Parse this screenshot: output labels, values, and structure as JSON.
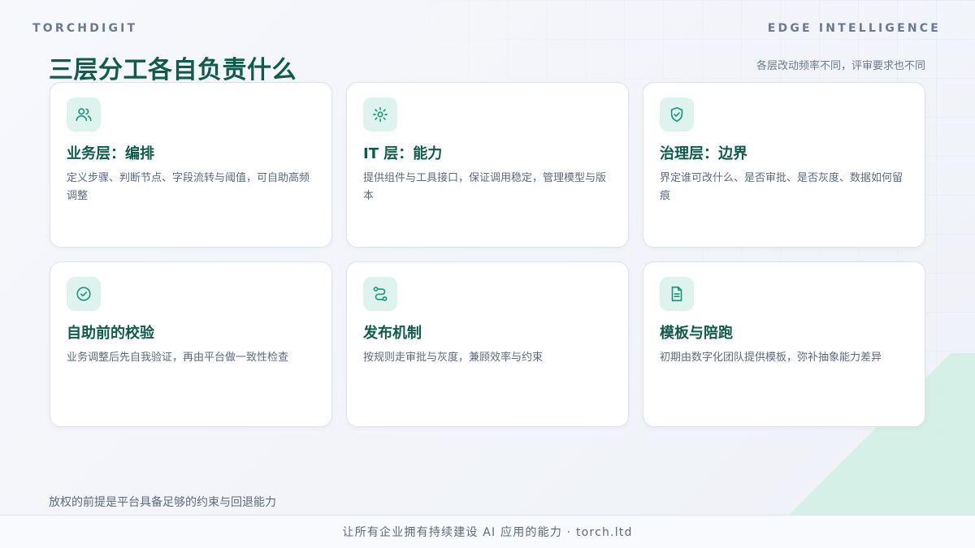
{
  "header": {
    "brand": "TORCHDIGIT",
    "tagline": "EDGE INTELLIGENCE"
  },
  "title": "三层分工各自负责什么",
  "subtitle": "各层改动频率不同，评审要求也不同",
  "cards": [
    {
      "icon": "users-icon",
      "title": "业务层：编排",
      "desc": "定义步骤、判断节点、字段流转与阈值，可自助高频调整"
    },
    {
      "icon": "gear-icon",
      "title": "IT 层：能力",
      "desc": "提供组件与工具接口，保证调用稳定，管理模型与版本"
    },
    {
      "icon": "shield-check-icon",
      "title": "治理层：边界",
      "desc": "界定谁可改什么、是否审批、是否灰度、数据如何留痕"
    },
    {
      "icon": "check-circle-icon",
      "title": "自助前的校验",
      "desc": "业务调整后先自我验证，再由平台做一致性检查"
    },
    {
      "icon": "route-icon",
      "title": "发布机制",
      "desc": "按规则走审批与灰度，兼顾效率与约束"
    },
    {
      "icon": "document-icon",
      "title": "模板与陪跑",
      "desc": "初期由数字化团队提供模板，弥补抽象能力差异"
    }
  ],
  "footer_note": "放权的前提是平台具备足够的约束与回退能力",
  "footer": "让所有企业拥有持续建设 AI 应用的能力 · torch.ltd",
  "colors": {
    "accent": "#0f5c4c",
    "icon_stroke": "#1a9a7c",
    "icon_bg": "#dff3ee"
  }
}
